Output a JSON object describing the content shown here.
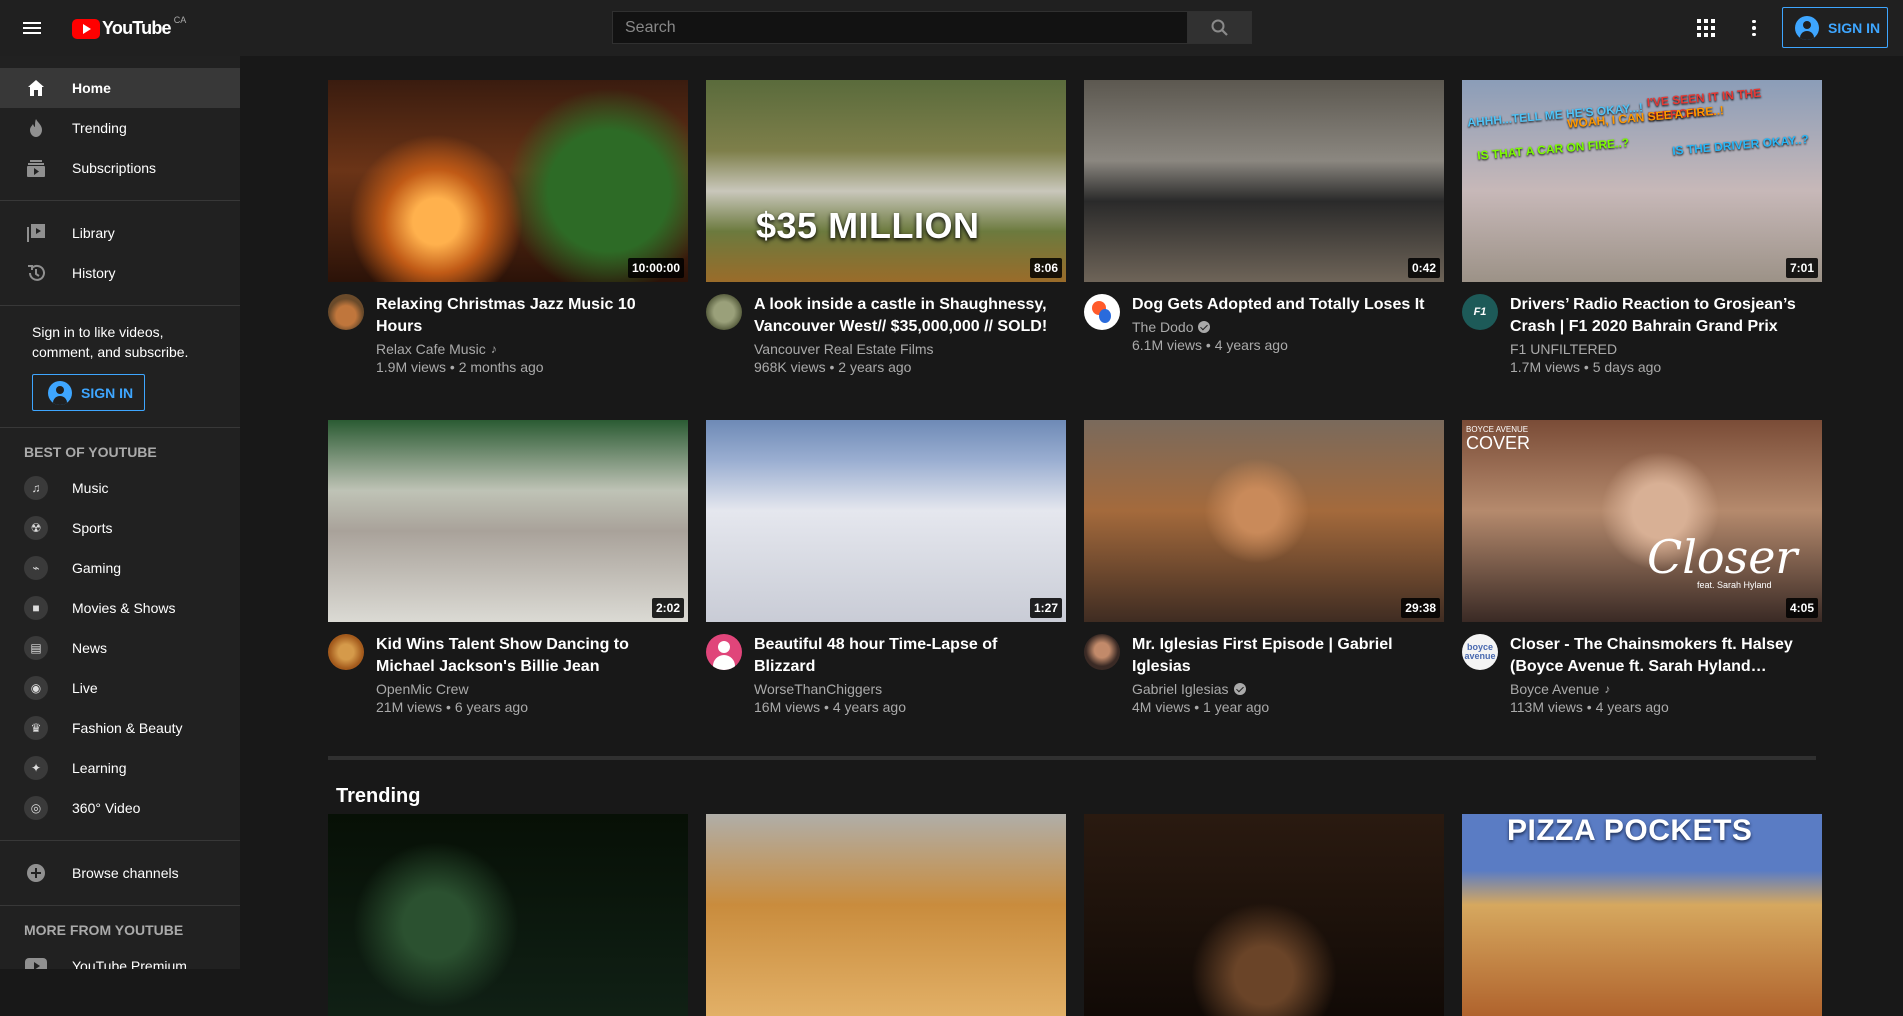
{
  "header": {
    "logo_text": "YouTube",
    "logo_country": "CA",
    "search_placeholder": "Search",
    "sign_in_label": "SIGN IN"
  },
  "sidebar": {
    "primary": [
      {
        "label": "Home",
        "icon": "home-icon",
        "active": true
      },
      {
        "label": "Trending",
        "icon": "trending-icon"
      },
      {
        "label": "Subscriptions",
        "icon": "subscriptions-icon"
      }
    ],
    "secondary": [
      {
        "label": "Library",
        "icon": "library-icon"
      },
      {
        "label": "History",
        "icon": "history-icon"
      }
    ],
    "signin_text": "Sign in to like videos, comment, and subscribe.",
    "signin_button": "SIGN IN",
    "best_header": "BEST OF YOUTUBE",
    "best": [
      {
        "label": "Music",
        "icon": "music-icon",
        "glyph": "♫"
      },
      {
        "label": "Sports",
        "icon": "sports-icon",
        "glyph": "☢"
      },
      {
        "label": "Gaming",
        "icon": "gaming-icon",
        "glyph": "⌁"
      },
      {
        "label": "Movies & Shows",
        "icon": "movies-icon",
        "glyph": "■"
      },
      {
        "label": "News",
        "icon": "news-icon",
        "glyph": "▤"
      },
      {
        "label": "Live",
        "icon": "live-icon",
        "glyph": "◉"
      },
      {
        "label": "Fashion & Beauty",
        "icon": "fashion-icon",
        "glyph": "♛"
      },
      {
        "label": "Learning",
        "icon": "learning-icon",
        "glyph": "✦"
      },
      {
        "label": "360° Video",
        "icon": "360-video-icon",
        "glyph": "◎"
      }
    ],
    "browse_channels": "Browse channels",
    "more_header": "MORE FROM YOUTUBE",
    "more": [
      {
        "label": "YouTube Premium",
        "icon": "youtube-premium-icon"
      }
    ]
  },
  "videos": [
    {
      "title": "Relaxing Christmas Jazz Music 10 Hours",
      "channel": "Relax Cafe Music",
      "badge": "music",
      "views": "1.9M views",
      "age": "2 months ago",
      "duration": "10:00:00"
    },
    {
      "title": "A look inside a castle in Shaughnessy, Vancouver West// $35,000,000 // SOLD!",
      "channel": "Vancouver Real Estate Films",
      "badge": "",
      "views": "968K views",
      "age": "2 years ago",
      "duration": "8:06",
      "overlay": "$35 MILLION"
    },
    {
      "title": "Dog Gets Adopted and Totally Loses It",
      "channel": "The Dodo",
      "badge": "verified",
      "views": "6.1M views",
      "age": "4 years ago",
      "duration": "0:42"
    },
    {
      "title": "Drivers’ Radio Reaction to Grosjean’s Crash | F1 2020 Bahrain Grand Prix",
      "channel": "F1 UNFILTERED",
      "badge": "",
      "views": "1.7M views",
      "age": "5 days ago",
      "duration": "7:01",
      "overlay_lines": [
        "AHHH...TELL ME HE'S OKAY...!",
        "I'VE SEEN IT IN THE MIRRORS...",
        "WOAH, I CAN SEE A FIRE..!",
        "IS THAT A CAR ON FIRE..?",
        "IS THE DRIVER OKAY..?"
      ],
      "avatar_text": "F1"
    },
    {
      "title": "Kid Wins Talent Show Dancing to Michael Jackson's Billie Jean",
      "channel": "OpenMic Crew",
      "badge": "",
      "views": "21M views",
      "age": "6 years ago",
      "duration": "2:02"
    },
    {
      "title": "Beautiful 48 hour Time-Lapse of Blizzard",
      "channel": "WorseThanChiggers",
      "badge": "",
      "views": "16M views",
      "age": "4 years ago",
      "duration": "1:27"
    },
    {
      "title": "Mr. Iglesias First Episode | Gabriel Iglesias",
      "channel": "Gabriel Iglesias",
      "badge": "verified",
      "views": "4M views",
      "age": "1 year ago",
      "duration": "29:38"
    },
    {
      "title": "Closer - The Chainsmokers ft. Halsey (Boyce Avenue ft. Sarah Hyland cover)...",
      "channel": "Boyce Avenue",
      "badge": "music",
      "views": "113M views",
      "age": "4 years ago",
      "duration": "4:05",
      "overlay_small": "BOYCE AVENUE",
      "overlay_cover": "COVER",
      "overlay_script": "Closer",
      "overlay_feat": "feat. Sarah Hyland",
      "avatar_text": "boyce avenue"
    }
  ],
  "trending": {
    "title": "Trending",
    "thumbs": [
      {
        "overlay": ""
      },
      {
        "overlay": ""
      },
      {
        "overlay": ""
      },
      {
        "overlay": "PIZZA POCKETS"
      }
    ]
  }
}
